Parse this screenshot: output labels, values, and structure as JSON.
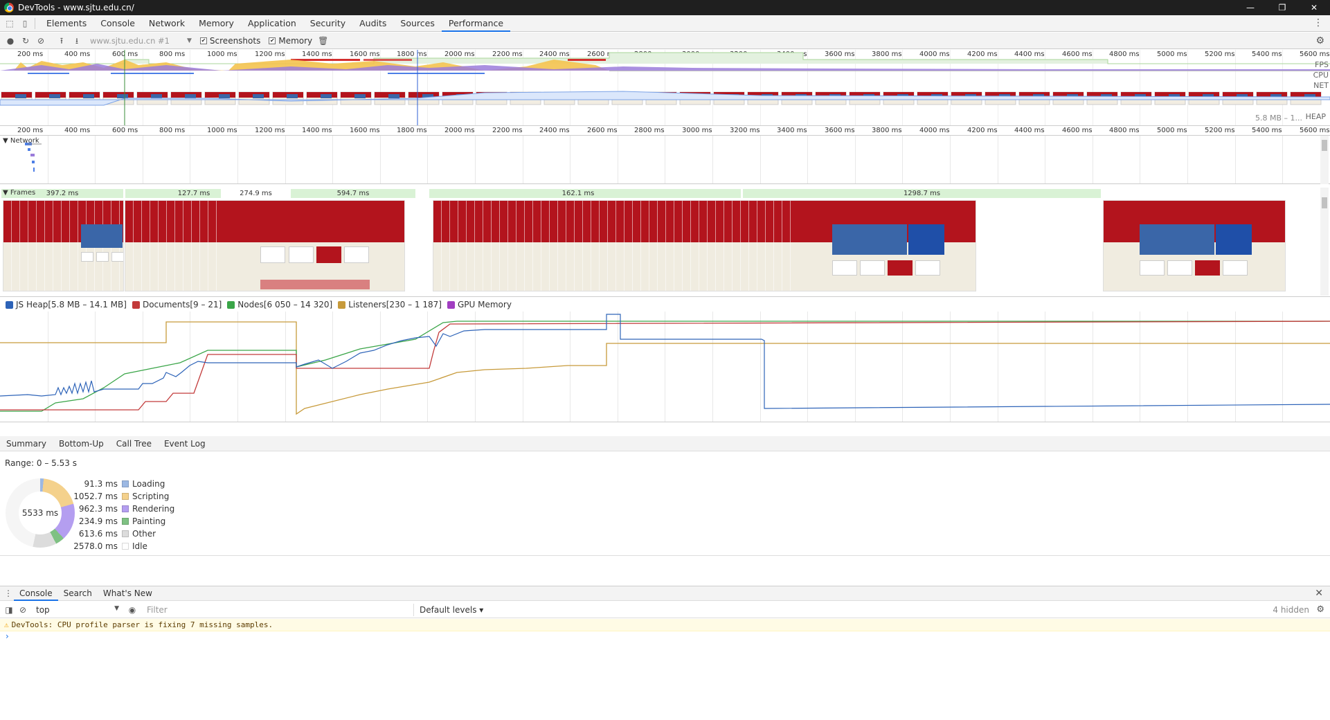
{
  "window": {
    "title": "DevTools - www.sjtu.edu.cn/",
    "controls": [
      "—",
      "❐",
      "✕"
    ]
  },
  "tabs": [
    "Elements",
    "Console",
    "Network",
    "Memory",
    "Application",
    "Security",
    "Audits",
    "Sources",
    "Performance"
  ],
  "active_tab": "Performance",
  "toolbar": {
    "url": "www.sjtu.edu.cn #1",
    "screenshots_label": "Screenshots",
    "memory_label": "Memory"
  },
  "overview": {
    "ruler_top": [
      "200 ms",
      "400 ms",
      "600 ms",
      "800 ms",
      "1000 ms",
      "1200 ms",
      "1400 ms",
      "1600 ms",
      "1800 ms",
      "2000 ms",
      "2200 ms",
      "2400 ms",
      "2600 ms",
      "2800 ms",
      "3000 ms",
      "3200 ms",
      "3400 ms",
      "3600 ms",
      "3800 ms",
      "4000 ms",
      "4200 ms",
      "4400 ms",
      "4600 ms",
      "4800 ms",
      "5000 ms",
      "5200 ms",
      "5400 ms",
      "5600 ms"
    ],
    "ruler_bottom": [
      "200 ms",
      "400 ms",
      "600 ms",
      "800 ms",
      "1000 ms",
      "1200 ms",
      "1400 ms",
      "1600 ms",
      "1800 ms",
      "2000 ms",
      "2200 ms",
      "2400 ms",
      "2600 ms",
      "2800 ms",
      "3000 ms",
      "3200 ms",
      "3400 ms",
      "3600 ms",
      "3800 ms",
      "4000 ms",
      "4200 ms",
      "4400 ms",
      "4600 ms",
      "4800 ms",
      "5000 ms",
      "5200 ms",
      "5400 ms",
      "5600 ms"
    ],
    "track_labels": [
      "FPS",
      "CPU",
      "NET"
    ],
    "heap_label": "HEAP",
    "heap_value": "5.8 MB – 1..."
  },
  "network": {
    "label": "Network"
  },
  "frames": {
    "label": "Frames",
    "durations": [
      "397.2 ms",
      "127.7 ms",
      "274.9 ms",
      "594.7 ms",
      "162.1 ms",
      "1298.7 ms"
    ]
  },
  "memory_legend": [
    {
      "label": "JS Heap[5.8 MB – 14.1 MB]",
      "color": "#2d63b8"
    },
    {
      "label": "Documents[9 – 21]",
      "color": "#c23a3a"
    },
    {
      "label": "Nodes[6 050 – 14 320]",
      "color": "#3aa548"
    },
    {
      "label": "Listeners[230 – 1 187]",
      "color": "#c79a3a"
    },
    {
      "label": "GPU Memory",
      "color": "#a13ec1"
    }
  ],
  "details_tabs": [
    "Summary",
    "Bottom-Up",
    "Call Tree",
    "Event Log"
  ],
  "summary": {
    "range": "Range: 0 – 5.53 s",
    "total": "5533 ms",
    "rows": [
      {
        "value": "91.3 ms",
        "label": "Loading",
        "color": "#9cb8e3"
      },
      {
        "value": "1052.7 ms",
        "label": "Scripting",
        "color": "#f4d18c"
      },
      {
        "value": "962.3 ms",
        "label": "Rendering",
        "color": "#b49ef0"
      },
      {
        "value": "234.9 ms",
        "label": "Painting",
        "color": "#7fc183"
      },
      {
        "value": "613.6 ms",
        "label": "Other",
        "color": "#dcdcdc"
      },
      {
        "value": "2578.0 ms",
        "label": "Idle",
        "color": "#ffffff"
      }
    ]
  },
  "drawer": {
    "tabs": [
      "Console",
      "Search",
      "What's New"
    ],
    "active": "Console",
    "context": "top",
    "filter_placeholder": "Filter",
    "levels": "Default levels ▾",
    "hidden": "4 hidden",
    "warning": "DevTools: CPU profile parser is fixing 7 missing samples.",
    "prompt": "›"
  }
}
